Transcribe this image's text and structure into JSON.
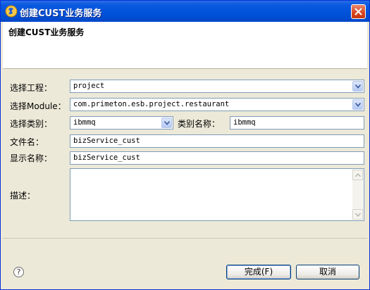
{
  "window": {
    "title": "创建CUST业务服务"
  },
  "header": {
    "title": "创建CUST业务服务"
  },
  "form": {
    "project_label": "选择工程：",
    "project_value": "project",
    "module_label": "选择Module：",
    "module_value": "com.primeton.esb.project.restaurant",
    "category_label": "选择类别：",
    "category_value": "ibmmq",
    "category_name_label": "类别名称：",
    "category_name_value": "ibmmq",
    "filename_label": "文件名：",
    "filename_value": "bizService_cust",
    "display_name_label": "显示名称：",
    "display_name_value": "bizService_cust",
    "description_label": "描述："
  },
  "footer": {
    "help_icon": "?",
    "finish_label": "完成(F)",
    "cancel_label": "取消"
  },
  "icons": {
    "app": "app-logo-icon",
    "close": "close-icon",
    "dropdown": "chevron-down-icon",
    "help": "help-icon"
  },
  "colors": {
    "titlebar": "#0052d8",
    "window_bg": "#ece9d8",
    "close_button": "#d8451e"
  }
}
